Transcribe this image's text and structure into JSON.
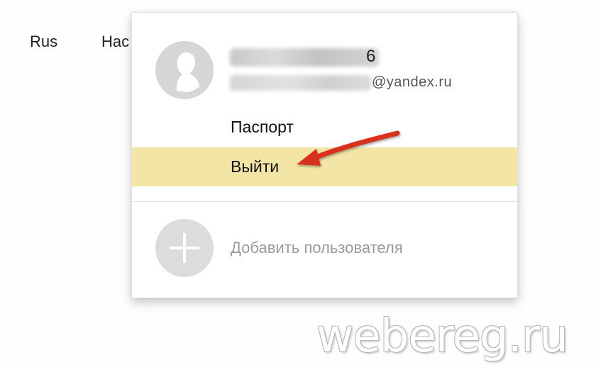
{
  "topnav": {
    "language": "Rus",
    "settings_partial": "Нас"
  },
  "account_popup": {
    "username_visible_tail": "6",
    "email_domain": "@yandex.ru",
    "menu": {
      "passport": "Паспорт",
      "logout": "Выйти"
    },
    "add_user_label": "Добавить пользователя",
    "highlight_color": "#f3e5a6",
    "arrow_color": "#d8321c"
  },
  "watermark": "webereg.ru"
}
